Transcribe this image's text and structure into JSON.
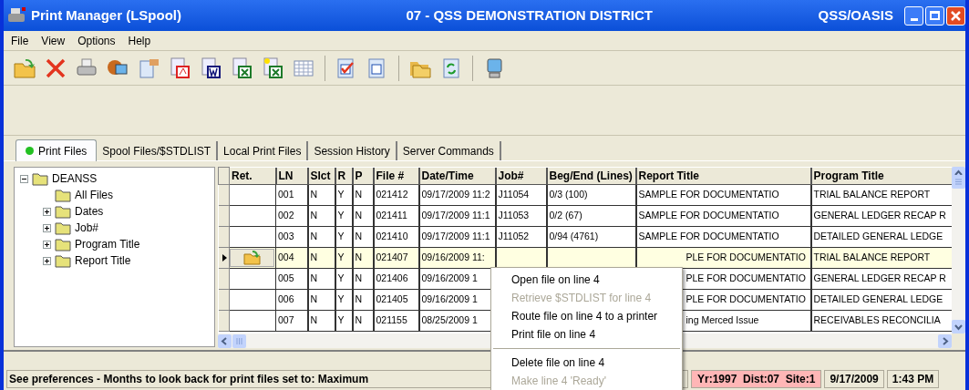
{
  "window": {
    "title": "Print Manager (LSpool)",
    "district": "07 - QSS DEMONSTRATION DISTRICT",
    "product": "QSS/OASIS"
  },
  "menu_bar": [
    "File",
    "View",
    "Options",
    "Help"
  ],
  "tabs": [
    {
      "label": "Print Files",
      "selected": true
    },
    {
      "label": "Spool Files/$STDLIST",
      "selected": false
    },
    {
      "label": "Local Print Files",
      "selected": false
    },
    {
      "label": "Session History",
      "selected": false
    },
    {
      "label": "Server Commands",
      "selected": false
    }
  ],
  "tree": {
    "label": "DEANSS",
    "expanded": true,
    "children": [
      {
        "label": "All Files"
      },
      {
        "label": "Dates",
        "expanded": false
      },
      {
        "label": "Job#",
        "expanded": false
      },
      {
        "label": "Program Title",
        "expanded": false
      },
      {
        "label": "Report Title",
        "expanded": false
      }
    ]
  },
  "table": {
    "columns": [
      "Ret.",
      "LN",
      "Slct",
      "R",
      "P",
      "File #",
      "Date/Time",
      "Job#",
      "Beg/End (Lines)",
      "Report Title",
      "Program Title"
    ],
    "rows": [
      {
        "selected": false,
        "under_menu": false,
        "cells": {
          "ln": "001",
          "slct": "N",
          "r": "Y",
          "p": "N",
          "file": "021412",
          "date": "09/17/2009 11:2",
          "job": "J11054",
          "lines": "0/3 (100)",
          "report": "SAMPLE FOR DOCUMENTATIO",
          "program": "TRIAL BALANCE REPORT"
        }
      },
      {
        "selected": false,
        "under_menu": false,
        "cells": {
          "ln": "002",
          "slct": "N",
          "r": "Y",
          "p": "N",
          "file": "021411",
          "date": "09/17/2009 11:1",
          "job": "J11053",
          "lines": "0/2 (67)",
          "report": "SAMPLE FOR DOCUMENTATIO",
          "program": "GENERAL LEDGER RECAP R"
        }
      },
      {
        "selected": false,
        "under_menu": false,
        "cells": {
          "ln": "003",
          "slct": "N",
          "r": "Y",
          "p": "N",
          "file": "021410",
          "date": "09/17/2009 11:1",
          "job": "J11052",
          "lines": "0/94 (4761)",
          "report": "SAMPLE FOR DOCUMENTATIO",
          "program": "DETAILED GENERAL LEDGE"
        }
      },
      {
        "selected": true,
        "under_menu": true,
        "cells": {
          "ln": "004",
          "slct": "N",
          "r": "Y",
          "p": "N",
          "file": "021407",
          "date": "09/16/2009 11:",
          "report": "PLE FOR DOCUMENTATIO",
          "program": "TRIAL BALANCE REPORT"
        }
      },
      {
        "selected": false,
        "under_menu": true,
        "cells": {
          "ln": "005",
          "slct": "N",
          "r": "Y",
          "p": "N",
          "file": "021406",
          "date": "09/16/2009 1",
          "report": "PLE FOR DOCUMENTATIO",
          "program": "GENERAL LEDGER RECAP R"
        }
      },
      {
        "selected": false,
        "under_menu": true,
        "cells": {
          "ln": "006",
          "slct": "N",
          "r": "Y",
          "p": "N",
          "file": "021405",
          "date": "09/16/2009 1",
          "report": "PLE FOR DOCUMENTATIO",
          "program": "DETAILED GENERAL LEDGE"
        }
      },
      {
        "selected": false,
        "under_menu": true,
        "cells": {
          "ln": "007",
          "slct": "N",
          "r": "Y",
          "p": "N",
          "file": "021155",
          "date": "08/25/2009 1",
          "report": "ing Merced Issue",
          "program": "RECEIVABLES RECONCILIA"
        }
      }
    ]
  },
  "context_menu": [
    {
      "kind": "item",
      "label": "Open file on line 4",
      "disabled": false
    },
    {
      "kind": "item",
      "label": "Retrieve $STDLIST for line 4",
      "disabled": true
    },
    {
      "kind": "item",
      "label": "Route file on line 4 to a printer",
      "disabled": false
    },
    {
      "kind": "item",
      "label": "Print file on line 4",
      "disabled": false
    },
    {
      "kind": "separator"
    },
    {
      "kind": "item",
      "label": "Delete file on line 4",
      "disabled": false
    },
    {
      "kind": "item",
      "label": "Make line 4 'Ready'",
      "disabled": true
    }
  ],
  "status_bar": {
    "message": "See preferences - Months to look back for print files set to: Maximum",
    "site": "Yr:1997  Dist:07  Site:1",
    "date": "9/17/2009",
    "time": "1:43 PM"
  }
}
